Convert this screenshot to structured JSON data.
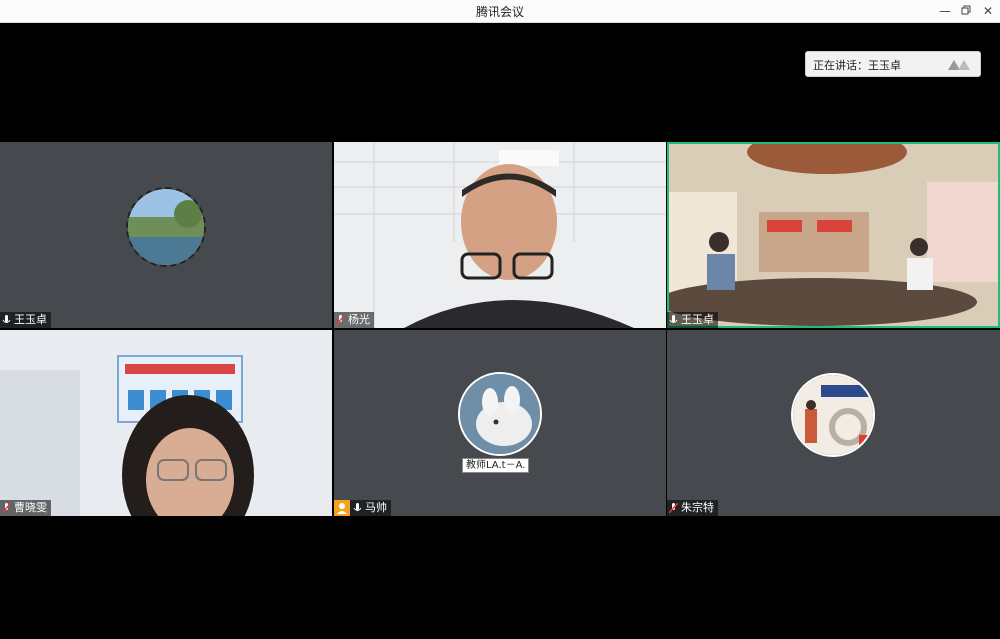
{
  "window": {
    "title": "腾讯会议"
  },
  "speaking": {
    "text": "正在讲话：王玉卓"
  },
  "participants": [
    {
      "name": "王玉卓"
    },
    {
      "name": "杨光"
    },
    {
      "name": "王玉卓"
    },
    {
      "name": "曹晓雯"
    },
    {
      "name": "马帅",
      "caption": "教师LA.t－A."
    },
    {
      "name": "朱宗特"
    }
  ],
  "colors": {
    "active_border": "#1dbd7a",
    "tile_bg": "#46494e",
    "host_badge": "#f2a21b"
  }
}
